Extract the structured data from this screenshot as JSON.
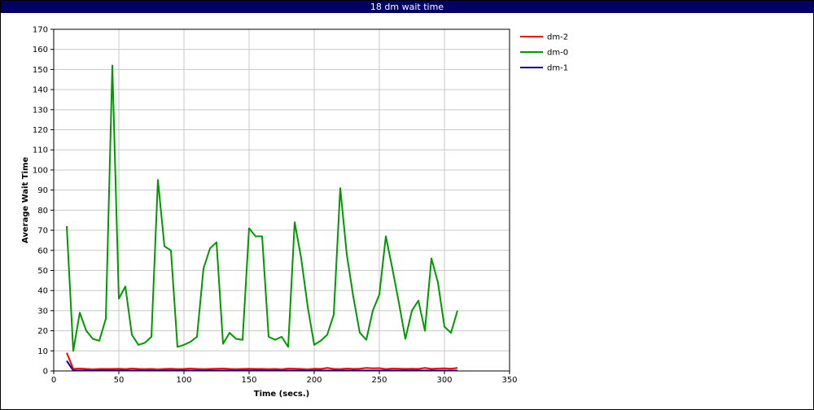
{
  "chart_data": {
    "type": "line",
    "title": "18 dm wait time",
    "xlabel": "Time (secs.)",
    "ylabel": "Average Wait Time",
    "xlim": [
      0,
      350
    ],
    "ylim": [
      0,
      170
    ],
    "xticks": [
      0,
      50,
      100,
      150,
      200,
      250,
      300,
      350
    ],
    "yticks": [
      0,
      10,
      20,
      30,
      40,
      50,
      60,
      70,
      80,
      90,
      100,
      110,
      120,
      130,
      140,
      150,
      160,
      170
    ],
    "grid": true,
    "legend_position": "right",
    "series": [
      {
        "name": "dm-2",
        "color": "#ff0000",
        "x": [
          10,
          15,
          20,
          25,
          30,
          35,
          40,
          45,
          50,
          55,
          60,
          65,
          70,
          75,
          80,
          85,
          90,
          95,
          100,
          105,
          110,
          115,
          120,
          125,
          130,
          135,
          140,
          145,
          150,
          155,
          160,
          165,
          170,
          175,
          180,
          185,
          190,
          195,
          200,
          205,
          210,
          215,
          220,
          225,
          230,
          235,
          240,
          245,
          250,
          255,
          260,
          265,
          270,
          275,
          280,
          285,
          290,
          295,
          300,
          305,
          310
        ],
        "y": [
          9,
          1,
          1.2,
          1,
          0.8,
          1,
          1,
          1,
          1.1,
          0.9,
          1.2,
          1,
          0.9,
          1,
          0.8,
          1,
          1.1,
          0.9,
          1,
          1.2,
          1,
          0.9,
          1,
          1.1,
          1.2,
          1,
          0.9,
          1,
          1.1,
          1,
          1,
          0.9,
          1,
          0.8,
          1.2,
          1.1,
          1,
          0.8,
          1.1,
          1,
          1.5,
          1,
          0.9,
          1.2,
          1,
          1.1,
          1.5,
          1.3,
          1.4,
          0.9,
          1.2,
          1.1,
          1,
          1.1,
          1,
          1.5,
          1,
          1.2,
          1.3,
          1.1,
          1.5
        ]
      },
      {
        "name": "dm-0",
        "color": "#009900",
        "x": [
          10,
          15,
          20,
          25,
          30,
          35,
          40,
          45,
          50,
          55,
          60,
          65,
          70,
          75,
          80,
          85,
          90,
          95,
          100,
          105,
          110,
          115,
          120,
          125,
          130,
          135,
          140,
          145,
          150,
          155,
          160,
          165,
          170,
          175,
          180,
          185,
          190,
          195,
          200,
          205,
          210,
          215,
          220,
          225,
          230,
          235,
          240,
          245,
          250,
          255,
          260,
          265,
          270,
          275,
          280,
          285,
          290,
          295,
          300,
          305,
          310
        ],
        "y": [
          72,
          10,
          29,
          20,
          16,
          15,
          26,
          152,
          36,
          42,
          18,
          13,
          14,
          17,
          95,
          62,
          60,
          12,
          13,
          14.5,
          17,
          51,
          61,
          64,
          13.5,
          19,
          16,
          15.5,
          71,
          67,
          67,
          17,
          15.5,
          17,
          12,
          74,
          56,
          32,
          13,
          15,
          18,
          28,
          91,
          58,
          37,
          19,
          15.5,
          30,
          38,
          67,
          51,
          34,
          16,
          30,
          35,
          20,
          56,
          44,
          22,
          19,
          30
        ]
      },
      {
        "name": "dm-1",
        "color": "#000099",
        "x": [
          10,
          15,
          20,
          25,
          30,
          35,
          40,
          45,
          50,
          55,
          60,
          65,
          70,
          75,
          80,
          85,
          90,
          95,
          100,
          105,
          110,
          115,
          120,
          125,
          130,
          135,
          140,
          145,
          150,
          155,
          160,
          165,
          170,
          175,
          180,
          185,
          190,
          195,
          200,
          205,
          210,
          215,
          220,
          225,
          230,
          235,
          240,
          245,
          250,
          255,
          260,
          265,
          270,
          275,
          280,
          285,
          290,
          295,
          300,
          305,
          310
        ],
        "y": [
          5,
          0.2,
          0.2,
          0.2,
          0.2,
          0.2,
          0.2,
          0.2,
          0.2,
          0.2,
          0.2,
          0.2,
          0.2,
          0.2,
          0.2,
          0.2,
          0.2,
          0.2,
          0.2,
          0.2,
          0.2,
          0.2,
          0.2,
          0.2,
          0.2,
          0.2,
          0.2,
          0.2,
          0.2,
          0.2,
          0.2,
          0.2,
          0.2,
          0.2,
          0.2,
          0.2,
          0.2,
          0.2,
          0.2,
          0.2,
          0.2,
          0.2,
          0.2,
          0.2,
          0.2,
          0.2,
          0.2,
          0.2,
          0.2,
          0.2,
          0.2,
          0.2,
          0.2,
          0.2,
          0.2,
          0.2,
          0.2,
          0.2,
          0.2,
          0.2,
          0.2
        ]
      }
    ],
    "legend_order": [
      "dm-2",
      "dm-0",
      "dm-1"
    ]
  }
}
